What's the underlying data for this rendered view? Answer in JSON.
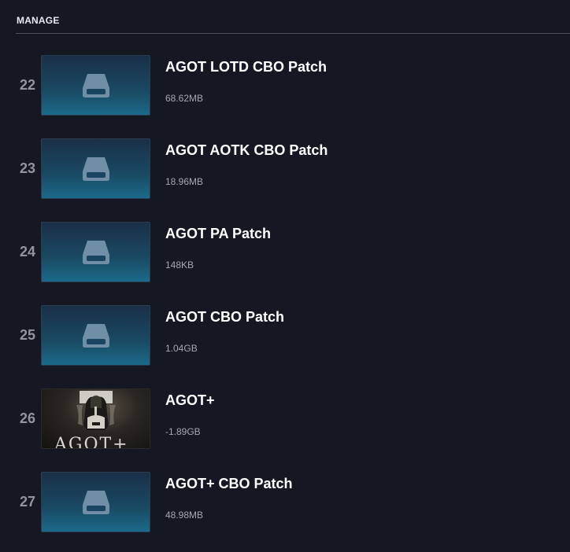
{
  "section": {
    "title": "MANAGE"
  },
  "items": [
    {
      "index": "22",
      "name": "AGOT LOTD CBO Patch",
      "size": "68.62MB",
      "thumb": "drive-icon"
    },
    {
      "index": "23",
      "name": "AGOT AOTK CBO Patch",
      "size": "18.96MB",
      "thumb": "drive-icon"
    },
    {
      "index": "24",
      "name": "AGOT PA Patch",
      "size": "148KB",
      "thumb": "drive-icon"
    },
    {
      "index": "25",
      "name": "AGOT CBO Patch",
      "size": "1.04GB",
      "thumb": "drive-icon"
    },
    {
      "index": "26",
      "name": "AGOT+",
      "size": "-1.89GB",
      "thumb": "agot-artwork",
      "art_text": "AGOT+"
    },
    {
      "index": "27",
      "name": "AGOT+ CBO Patch",
      "size": "48.98MB",
      "thumb": "drive-icon"
    }
  ],
  "colors": {
    "background": "#151823",
    "thumb_gradient_top": "#1a2f47",
    "thumb_gradient_bottom": "#1b6a8a",
    "index_text": "#8f95a3",
    "size_text": "#a3a8b3"
  }
}
